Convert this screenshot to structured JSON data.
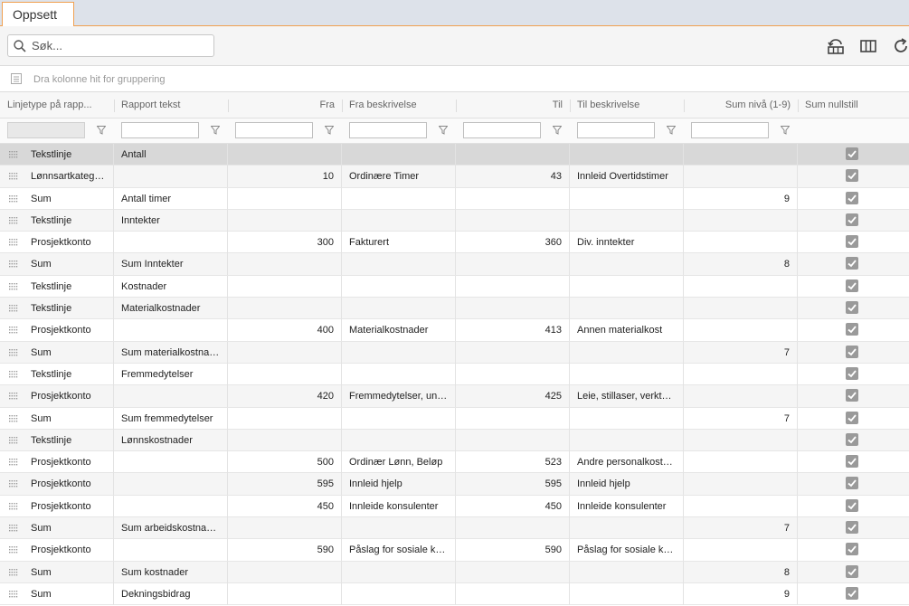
{
  "tab": {
    "label": "Oppsett"
  },
  "search": {
    "placeholder": "Søk..."
  },
  "toolbar": {
    "icons": [
      "reset-layout-icon",
      "columns-icon",
      "refresh-icon"
    ]
  },
  "groupbar": {
    "text": "Dra kolonne hit for gruppering"
  },
  "columns": [
    "Linjetype på rapp...",
    "Rapport tekst",
    "Fra",
    "Fra beskrivelse",
    "Til",
    "Til beskrivelse",
    "Sum nivå (1-9)",
    "Sum nullstill"
  ],
  "rows": [
    {
      "type": "Tekstlinje",
      "text": "Antall",
      "fra": "",
      "fra_desc": "",
      "til": "",
      "til_desc": "",
      "sum": "",
      "reset": true
    },
    {
      "type": "Lønnsartkatego...",
      "text": "",
      "fra": "10",
      "fra_desc": "Ordinære Timer",
      "til": "43",
      "til_desc": "Innleid Overtidstimer",
      "sum": "",
      "reset": true
    },
    {
      "type": "Sum",
      "text": "Antall timer",
      "fra": "",
      "fra_desc": "",
      "til": "",
      "til_desc": "",
      "sum": "9",
      "reset": true
    },
    {
      "type": "Tekstlinje",
      "text": "Inntekter",
      "fra": "",
      "fra_desc": "",
      "til": "",
      "til_desc": "",
      "sum": "",
      "reset": true
    },
    {
      "type": "Prosjektkonto",
      "text": "",
      "fra": "300",
      "fra_desc": "Fakturert",
      "til": "360",
      "til_desc": "Div. inntekter",
      "sum": "",
      "reset": true
    },
    {
      "type": "Sum",
      "text": "Sum Inntekter",
      "fra": "",
      "fra_desc": "",
      "til": "",
      "til_desc": "",
      "sum": "8",
      "reset": true
    },
    {
      "type": "Tekstlinje",
      "text": "Kostnader",
      "fra": "",
      "fra_desc": "",
      "til": "",
      "til_desc": "",
      "sum": "",
      "reset": true
    },
    {
      "type": "Tekstlinje",
      "text": "Materialkostnader",
      "fra": "",
      "fra_desc": "",
      "til": "",
      "til_desc": "",
      "sum": "",
      "reset": true
    },
    {
      "type": "Prosjektkonto",
      "text": "",
      "fra": "400",
      "fra_desc": "Materialkostnader",
      "til": "413",
      "til_desc": "Annen materialkost",
      "sum": "",
      "reset": true
    },
    {
      "type": "Sum",
      "text": "Sum materialkostnad...",
      "fra": "",
      "fra_desc": "",
      "til": "",
      "til_desc": "",
      "sum": "7",
      "reset": true
    },
    {
      "type": "Tekstlinje",
      "text": "Fremmedytelser",
      "fra": "",
      "fra_desc": "",
      "til": "",
      "til_desc": "",
      "sum": "",
      "reset": true
    },
    {
      "type": "Prosjektkonto",
      "text": "",
      "fra": "420",
      "fra_desc": "Fremmedytelser, und...",
      "til": "425",
      "til_desc": "Leie, stillaser, verktøy...",
      "sum": "",
      "reset": true
    },
    {
      "type": "Sum",
      "text": "Sum fremmedytelser",
      "fra": "",
      "fra_desc": "",
      "til": "",
      "til_desc": "",
      "sum": "7",
      "reset": true
    },
    {
      "type": "Tekstlinje",
      "text": "Lønnskostnader",
      "fra": "",
      "fra_desc": "",
      "til": "",
      "til_desc": "",
      "sum": "",
      "reset": true
    },
    {
      "type": "Prosjektkonto",
      "text": "",
      "fra": "500",
      "fra_desc": "Ordinær Lønn, Beløp",
      "til": "523",
      "til_desc": "Andre personalkostn...",
      "sum": "",
      "reset": true
    },
    {
      "type": "Prosjektkonto",
      "text": "",
      "fra": "595",
      "fra_desc": "Innleid hjelp",
      "til": "595",
      "til_desc": "Innleid hjelp",
      "sum": "",
      "reset": true
    },
    {
      "type": "Prosjektkonto",
      "text": "",
      "fra": "450",
      "fra_desc": "Innleide konsulenter",
      "til": "450",
      "til_desc": "Innleide konsulenter",
      "sum": "",
      "reset": true
    },
    {
      "type": "Sum",
      "text": "Sum arbeidskostnader",
      "fra": "",
      "fra_desc": "",
      "til": "",
      "til_desc": "",
      "sum": "7",
      "reset": true
    },
    {
      "type": "Prosjektkonto",
      "text": "",
      "fra": "590",
      "fra_desc": "Påslag for sosiale kos...",
      "til": "590",
      "til_desc": "Påslag for sosiale kos...",
      "sum": "",
      "reset": true
    },
    {
      "type": "Sum",
      "text": "Sum kostnader",
      "fra": "",
      "fra_desc": "",
      "til": "",
      "til_desc": "",
      "sum": "8",
      "reset": true
    },
    {
      "type": "Sum",
      "text": "Dekningsbidrag",
      "fra": "",
      "fra_desc": "",
      "til": "",
      "til_desc": "",
      "sum": "9",
      "reset": true
    }
  ],
  "colors": {
    "accent": "#f0a050",
    "selected_row": "#d8d8d8",
    "checkbox": "#9a9a9a"
  }
}
